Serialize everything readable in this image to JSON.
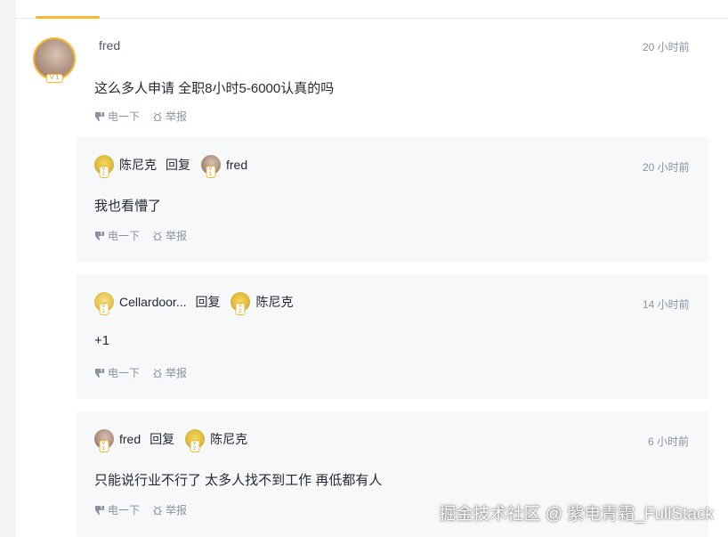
{
  "main_comment": {
    "author": "fred",
    "level": "V 1",
    "time": "20 小时前",
    "text": "这么多人申请 全职8小时5-6000认真的吗",
    "dislike": "电一下",
    "report": "举报"
  },
  "replies": [
    {
      "author": "陈尼克",
      "author_level": "V 2",
      "reply_label": "回复",
      "target": "fred",
      "target_level": "V 1",
      "time": "20 小时前",
      "text": "我也看懵了",
      "dislike": "电一下",
      "report": "举报"
    },
    {
      "author": "Cellardoor...",
      "author_level": "V 1",
      "reply_label": "回复",
      "target": "陈尼克",
      "target_level": "V 2",
      "time": "14 小时前",
      "text": "+1",
      "dislike": "电一下",
      "report": "举报"
    },
    {
      "author": "fred",
      "author_level": "V 1",
      "reply_label": "回复",
      "target": "陈尼克",
      "target_level": "V 2",
      "time": "6 小时前",
      "text": "只能说行业不行了 太多人找不到工作 再低都有人",
      "dislike": "电一下",
      "report": "举报"
    }
  ],
  "watermark": "掘金技术社区 @ 紫电青霜_FullStack",
  "colors": {
    "accent": "#f7b731",
    "muted": "#8a919f",
    "text": "#252933",
    "reply_bg": "#f7f8fa"
  }
}
